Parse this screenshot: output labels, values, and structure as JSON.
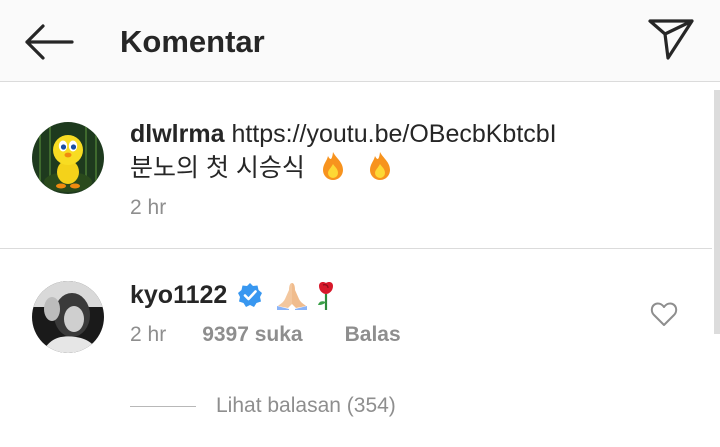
{
  "header": {
    "title": "Komentar",
    "back_icon": "arrow-left-icon",
    "share_icon": "paper-plane-icon"
  },
  "caption": {
    "username": "dlwlrma",
    "link": "https://youtu.be/OBecbKbtcbI",
    "text": "분노의 첫 시승식",
    "emojis": [
      "fire",
      "fire"
    ],
    "time": "2 hr"
  },
  "comment": {
    "username": "kyo1122",
    "verified": true,
    "emojis": [
      "folded-hands",
      "rose"
    ],
    "time": "2 hr",
    "likes": "9397 suka",
    "reply_label": "Balas",
    "view_replies": "Lihat balasan (354)"
  },
  "colors": {
    "text": "#262626",
    "meta": "#8e8e8e",
    "verified": "#3897f0",
    "header_bg": "#fafafa",
    "divider": "#dbdbdb"
  }
}
